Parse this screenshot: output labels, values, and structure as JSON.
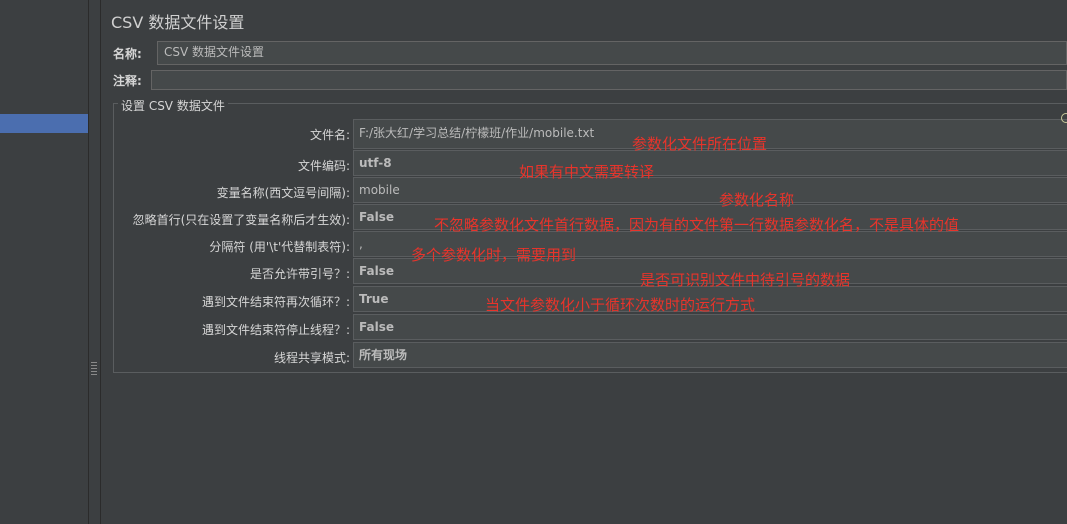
{
  "panel_title": "CSV 数据文件设置",
  "name_label": "名称:",
  "name_value": "CSV 数据文件设置",
  "comment_label": "注释:",
  "comment_value": "",
  "group_title": "设置 CSV 数据文件",
  "rows": [
    {
      "label": "文件名:",
      "value": "F:/张大红/学习总结/柠檬班/作业/mobile.txt"
    },
    {
      "label": "文件编码:",
      "value": "utf-8"
    },
    {
      "label": "变量名称(西文逗号间隔):",
      "value": "mobile"
    },
    {
      "label": "忽略首行(只在设置了变量名称后才生效):",
      "value": "False"
    },
    {
      "label": "分隔符 (用'\\t'代替制表符):",
      "value": ","
    },
    {
      "label": "是否允许带引号？:",
      "value": "False"
    },
    {
      "label": "遇到文件结束符再次循环？:",
      "value": "True"
    },
    {
      "label": "遇到文件结束符停止线程？:",
      "value": "False"
    },
    {
      "label": "线程共享模式:",
      "value": "所有现场"
    }
  ],
  "annotations": [
    "参数化文件所在位置",
    "如果有中文需要转译",
    "参数化名称",
    "不忽略参数化文件首行数据，因为有的文件第一行数据参数化名，不是具体的值",
    "多个参数化时，需要用到",
    "是否可识别文件中待引号的数据",
    "当文件参数化小于循环次数时的运行方式"
  ],
  "colors": {
    "annotation": "#e8342b",
    "background": "#3c3f41",
    "selection": "#4b6eaf"
  }
}
